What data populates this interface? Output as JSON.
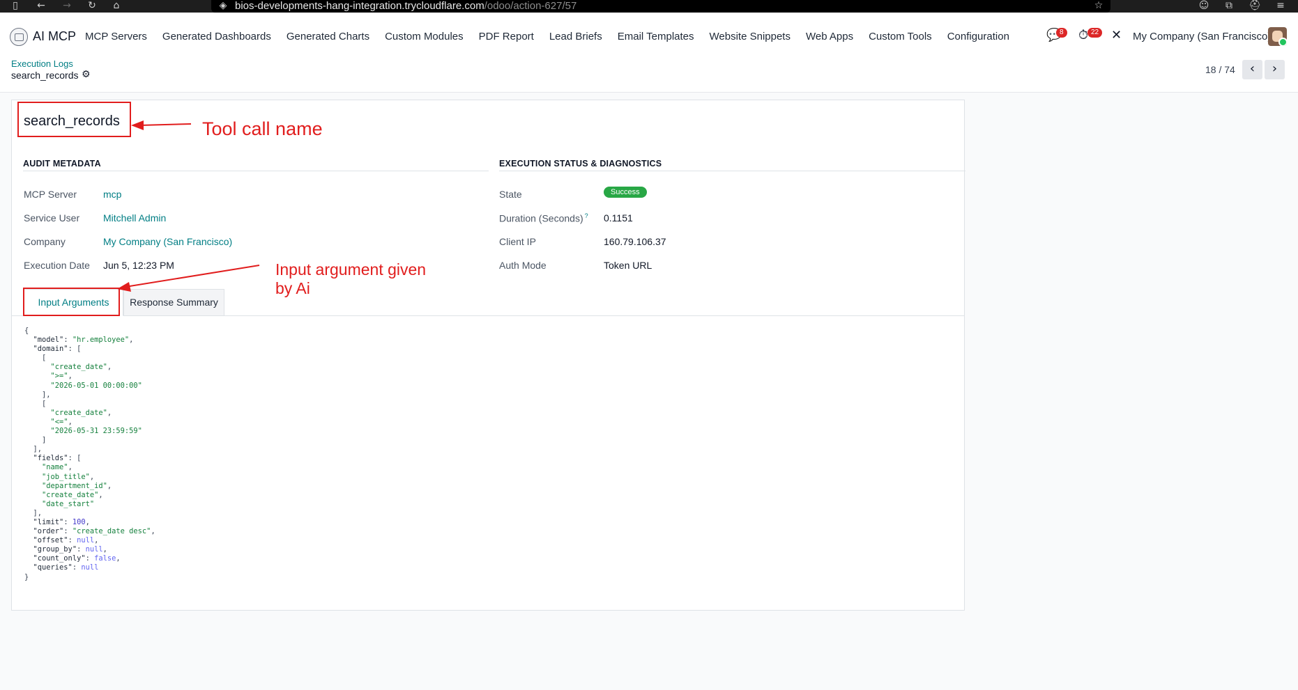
{
  "browser": {
    "url_host": "bios-developments-hang-integration.trycloudflare.com",
    "url_path": "/odoo/action-627/57"
  },
  "nav": {
    "app_name": "AI MCP",
    "menu": [
      "MCP Servers",
      "Generated Dashboards",
      "Generated Charts",
      "Custom Modules",
      "PDF Report",
      "Lead Briefs",
      "Email Templates",
      "Website Snippets",
      "Web Apps",
      "Custom Tools",
      "Configuration"
    ],
    "messages_count": "8",
    "activities_count": "22",
    "company": "My Company (San Francisco)"
  },
  "control": {
    "breadcrumb_parent": "Execution Logs",
    "breadcrumb_current": "search_records",
    "pager": "18 / 74"
  },
  "record": {
    "title": "search_records",
    "audit_title": "AUDIT METADATA",
    "status_title": "EXECUTION STATUS & DIAGNOSTICS",
    "audit": [
      {
        "label": "MCP Server",
        "value": "mcp"
      },
      {
        "label": "Service User",
        "value": "Mitchell Admin"
      },
      {
        "label": "Company",
        "value": "My Company (San Francisco)"
      },
      {
        "label": "Execution Date",
        "value": "Jun 5, 12:23 PM"
      }
    ],
    "status": [
      {
        "label": "State",
        "value": "Success"
      },
      {
        "label": "Duration (Seconds)",
        "value": "0.1151",
        "help": "?"
      },
      {
        "label": "Client IP",
        "value": "160.79.106.37"
      },
      {
        "label": "Auth Mode",
        "value": "Token URL"
      }
    ],
    "tabs": [
      "Input Arguments",
      "Response Summary"
    ]
  },
  "code_lines": [
    [
      [
        "p",
        "{"
      ]
    ],
    [
      [
        "p",
        "  "
      ],
      [
        "k",
        "\"model\""
      ],
      [
        "p",
        ": "
      ],
      [
        "s",
        "\"hr.employee\""
      ],
      [
        "p",
        ","
      ]
    ],
    [
      [
        "p",
        "  "
      ],
      [
        "k",
        "\"domain\""
      ],
      [
        "p",
        ": ["
      ]
    ],
    [
      [
        "p",
        "    ["
      ]
    ],
    [
      [
        "p",
        "      "
      ],
      [
        "s",
        "\"create_date\""
      ],
      [
        "p",
        ","
      ]
    ],
    [
      [
        "p",
        "      "
      ],
      [
        "s",
        "\">=\""
      ],
      [
        "p",
        ","
      ]
    ],
    [
      [
        "p",
        "      "
      ],
      [
        "s",
        "\"2026-05-01 00:00:00\""
      ]
    ],
    [
      [
        "p",
        "    ],"
      ]
    ],
    [
      [
        "p",
        "    ["
      ]
    ],
    [
      [
        "p",
        "      "
      ],
      [
        "s",
        "\"create_date\""
      ],
      [
        "p",
        ","
      ]
    ],
    [
      [
        "p",
        "      "
      ],
      [
        "s",
        "\"<=\""
      ],
      [
        "p",
        ","
      ]
    ],
    [
      [
        "p",
        "      "
      ],
      [
        "s",
        "\"2026-05-31 23:59:59\""
      ]
    ],
    [
      [
        "p",
        "    ]"
      ]
    ],
    [
      [
        "p",
        "  ],"
      ]
    ],
    [
      [
        "p",
        "  "
      ],
      [
        "k",
        "\"fields\""
      ],
      [
        "p",
        ": ["
      ]
    ],
    [
      [
        "p",
        "    "
      ],
      [
        "s",
        "\"name\""
      ],
      [
        "p",
        ","
      ]
    ],
    [
      [
        "p",
        "    "
      ],
      [
        "s",
        "\"job_title\""
      ],
      [
        "p",
        ","
      ]
    ],
    [
      [
        "p",
        "    "
      ],
      [
        "s",
        "\"department_id\""
      ],
      [
        "p",
        ","
      ]
    ],
    [
      [
        "p",
        "    "
      ],
      [
        "s",
        "\"create_date\""
      ],
      [
        "p",
        ","
      ]
    ],
    [
      [
        "p",
        "    "
      ],
      [
        "s",
        "\"date_start\""
      ]
    ],
    [
      [
        "p",
        "  ],"
      ]
    ],
    [
      [
        "p",
        "  "
      ],
      [
        "k",
        "\"limit\""
      ],
      [
        "p",
        ": "
      ],
      [
        "n",
        "100"
      ],
      [
        "p",
        ","
      ]
    ],
    [
      [
        "p",
        "  "
      ],
      [
        "k",
        "\"order\""
      ],
      [
        "p",
        ": "
      ],
      [
        "s",
        "\"create_date desc\""
      ],
      [
        "p",
        ","
      ]
    ],
    [
      [
        "p",
        "  "
      ],
      [
        "k",
        "\"offset\""
      ],
      [
        "p",
        ": "
      ],
      [
        "kw",
        "null"
      ],
      [
        "p",
        ","
      ]
    ],
    [
      [
        "p",
        "  "
      ],
      [
        "k",
        "\"group_by\""
      ],
      [
        "p",
        ": "
      ],
      [
        "kw",
        "null"
      ],
      [
        "p",
        ","
      ]
    ],
    [
      [
        "p",
        "  "
      ],
      [
        "k",
        "\"count_only\""
      ],
      [
        "p",
        ": "
      ],
      [
        "kw",
        "false"
      ],
      [
        "p",
        ","
      ]
    ],
    [
      [
        "p",
        "  "
      ],
      [
        "k",
        "\"queries\""
      ],
      [
        "p",
        ": "
      ],
      [
        "kw",
        "null"
      ]
    ],
    [
      [
        "p",
        "}"
      ]
    ]
  ],
  "annotations": {
    "tool_call_name": "Tool call name",
    "input_argument_line1": "Input argument given",
    "input_argument_line2": "by Ai",
    "color": "#e11d1d"
  },
  "colors": {
    "link": "#017e84",
    "success": "#28a745",
    "badge": "#dc2626"
  }
}
